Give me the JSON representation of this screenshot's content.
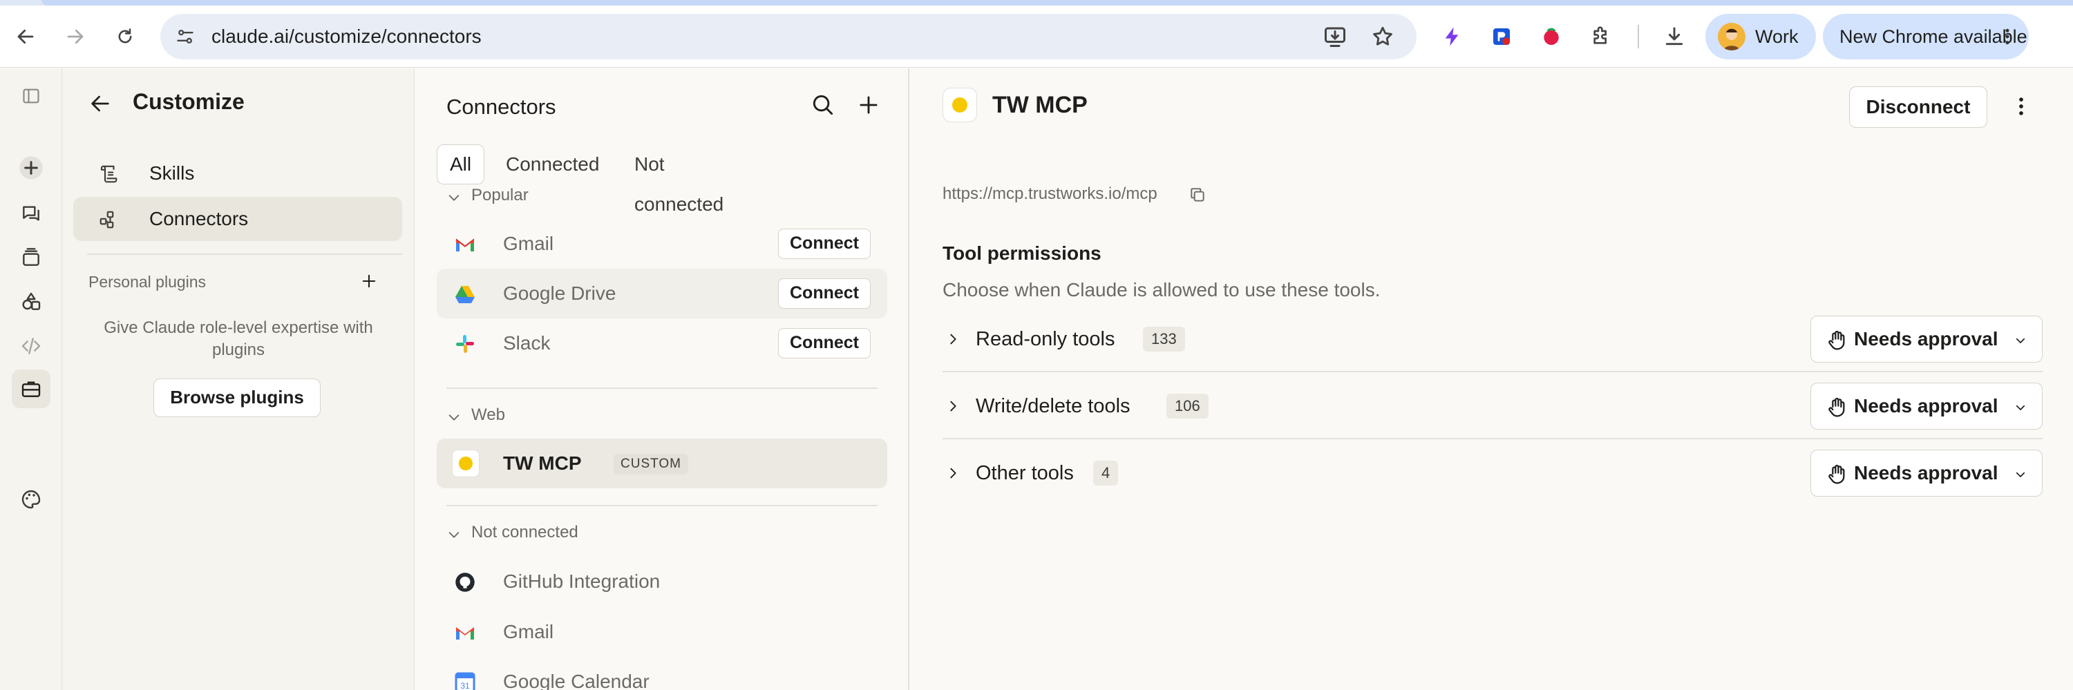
{
  "browser": {
    "url": "claude.ai/customize/connectors",
    "profile_label": "Work",
    "update_label": "New Chrome available"
  },
  "sidebar": {
    "title": "Customize",
    "items": [
      {
        "label": "Skills",
        "icon": "skills-icon"
      },
      {
        "label": "Connectors",
        "icon": "connectors-icon",
        "active": true
      }
    ],
    "personal_plugins_label": "Personal plugins",
    "plugins_blurb": "Give Claude role-level expertise with plugins",
    "browse_plugins_label": "Browse plugins"
  },
  "connectors": {
    "title": "Connectors",
    "tabs": [
      "All",
      "Connected",
      "Not connected"
    ],
    "active_tab": "All",
    "groups": {
      "popular": {
        "label": "Popular",
        "items": [
          {
            "name": "Gmail",
            "action": "Connect",
            "icon": "gmail-icon"
          },
          {
            "name": "Google Drive",
            "action": "Connect",
            "icon": "google-drive-icon"
          },
          {
            "name": "Slack",
            "action": "Connect",
            "icon": "slack-icon"
          }
        ]
      },
      "web": {
        "label": "Web",
        "items": [
          {
            "name": "TW MCP",
            "badge": "CUSTOM",
            "icon": "yellow-dot-icon"
          }
        ]
      },
      "not_connected": {
        "label": "Not connected",
        "items": [
          {
            "name": "GitHub Integration",
            "icon": "github-icon"
          },
          {
            "name": "Gmail",
            "icon": "gmail-icon"
          },
          {
            "name": "Google Calendar",
            "icon": "google-calendar-icon"
          }
        ]
      }
    }
  },
  "detail": {
    "name": "TW MCP",
    "disconnect_label": "Disconnect",
    "url": "https://mcp.trustworks.io/mcp",
    "permissions_title": "Tool permissions",
    "permissions_subtitle": "Choose when Claude is allowed to use these tools.",
    "tool_groups": [
      {
        "label": "Read-only tools",
        "count": "133",
        "setting": "Needs approval"
      },
      {
        "label": "Write/delete tools",
        "count": "106",
        "setting": "Needs approval"
      },
      {
        "label": "Other tools",
        "count": "4",
        "setting": "Needs approval"
      }
    ]
  },
  "colors": {
    "accent_yellow": "#f5c800",
    "chrome_pill": "#d3e3fd",
    "background": "#faf9f5"
  }
}
